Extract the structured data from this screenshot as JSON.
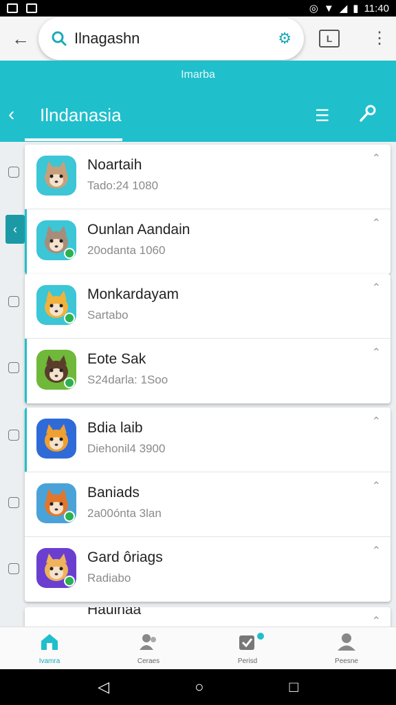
{
  "status_bar": {
    "time": "11:40"
  },
  "search": {
    "query": "Ilnagashn"
  },
  "header": {
    "subtitle": "Imarba",
    "title": "Ilndanasia"
  },
  "groups": [
    {
      "items": [
        {
          "title": "Noartaih",
          "subtitle": "Tado:24 1080",
          "accent": false,
          "badge": false,
          "icon": "cat-app-icon",
          "colors": [
            "#3cc6d6",
            "#c7a07a"
          ]
        },
        {
          "title": "Ounlan Aandain",
          "subtitle": "20odanta 1060",
          "accent": true,
          "badge": true,
          "icon": "cat-app-icon",
          "colors": [
            "#3cc6d6",
            "#a88c7a"
          ]
        }
      ]
    },
    {
      "items": [
        {
          "title": "Monkardayam",
          "subtitle": "Sartabo",
          "accent": false,
          "badge": true,
          "icon": "fox-app-icon",
          "colors": [
            "#3cc6d6",
            "#f0b23c"
          ]
        },
        {
          "title": "Eote Sak",
          "subtitle": "S24darla: 1Soo",
          "accent": true,
          "badge": true,
          "icon": "ninja-app-icon",
          "colors": [
            "#6fb83a",
            "#5a3d2b"
          ]
        }
      ]
    },
    {
      "items": [
        {
          "title": "Bdia laib",
          "subtitle": "Diehonil4 3900",
          "accent": true,
          "badge": false,
          "icon": "warrior-app-icon",
          "colors": [
            "#2f6bd8",
            "#f0a030"
          ]
        },
        {
          "title": "Baniads",
          "subtitle": "2a00ónta 3lan",
          "accent": false,
          "badge": true,
          "icon": "hero-app-icon",
          "colors": [
            "#4aa3d8",
            "#e2762c"
          ]
        },
        {
          "title": "Gard ôriags",
          "subtitle": "Radiabo",
          "accent": false,
          "badge": true,
          "icon": "fox-girl-app-icon",
          "colors": [
            "#6a3fd0",
            "#f0b25a"
          ]
        }
      ]
    }
  ],
  "partial_row": {
    "title": "Haulhaa"
  },
  "bottom_nav": [
    {
      "label": "Ivamra",
      "icon": "home-icon",
      "active": true
    },
    {
      "label": "Ceraes",
      "icon": "people-icon",
      "active": false
    },
    {
      "label": "Perisd",
      "icon": "checkbox-icon",
      "active": false
    },
    {
      "label": "Peesne",
      "icon": "person-icon",
      "active": false
    }
  ],
  "colors": {
    "accent": "#1fbfcc",
    "accent_dark": "#1b9aa6",
    "badge": "#29b24f"
  }
}
